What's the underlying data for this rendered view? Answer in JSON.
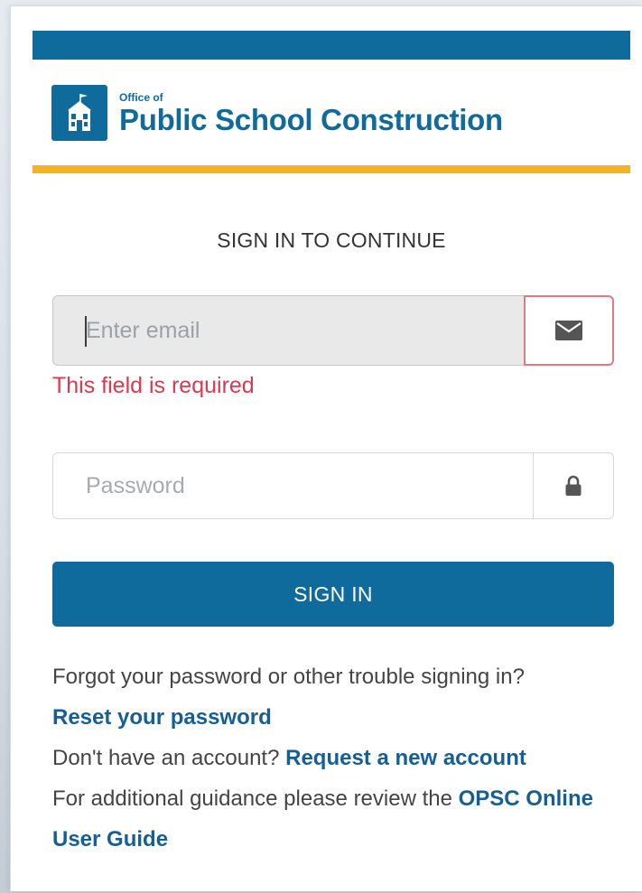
{
  "header": {
    "logo_small": "Office of",
    "logo_big": "Public School Construction"
  },
  "heading": "SIGN IN TO CONTINUE",
  "email": {
    "placeholder": "Enter email",
    "value": "",
    "icon": "envelope-icon",
    "error": "This field is required"
  },
  "password": {
    "placeholder": "Password",
    "value": "",
    "icon": "lock-icon"
  },
  "signin_label": "SIGN IN",
  "help": {
    "trouble_text": "Forgot your password or other trouble signing in?",
    "reset_link": "Reset your password",
    "no_account_text": "Don't have an account?",
    "request_link": "Request a new account",
    "guidance_text": "For additional guidance please review the",
    "guide_link": "OPSC Online User Guide"
  },
  "colors": {
    "brand_blue": "#0e6b9c",
    "accent_gold": "#f5b324",
    "error_red": "#d93a4f"
  }
}
